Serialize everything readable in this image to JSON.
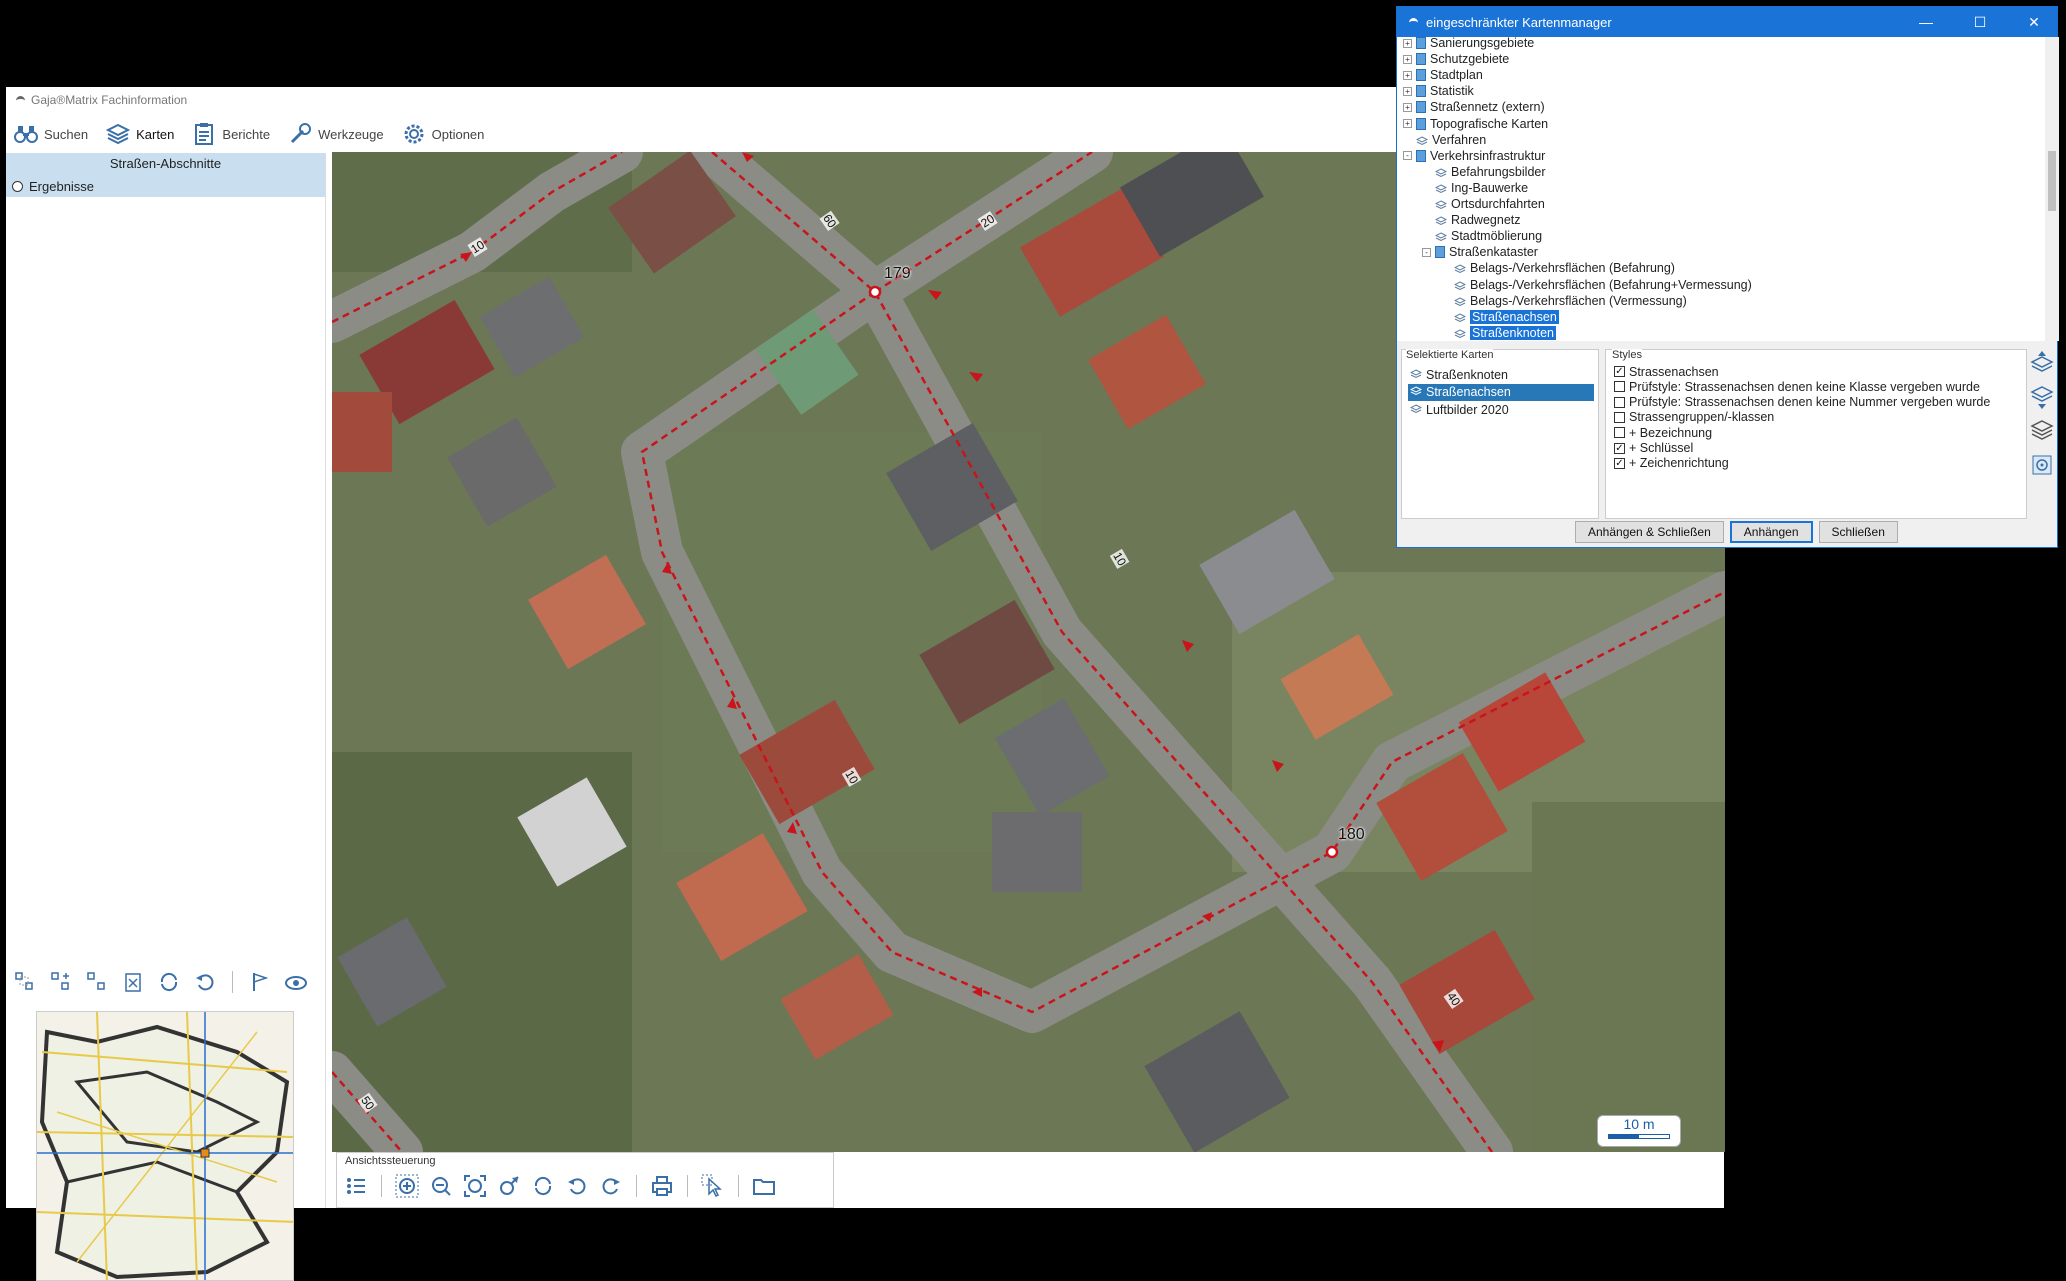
{
  "app": {
    "title": "Gaja®Matrix Fachinformation",
    "toolbar": [
      {
        "label": "Suchen",
        "icon": "binoculars-icon"
      },
      {
        "label": "Karten",
        "icon": "layers-icon"
      },
      {
        "label": "Berichte",
        "icon": "report-icon"
      },
      {
        "label": "Werkzeuge",
        "icon": "wrench-icon"
      },
      {
        "label": "Optionen",
        "icon": "gear-icon"
      }
    ],
    "active_tab": "Karten"
  },
  "left_panel": {
    "header": "Straßen-Abschnitte",
    "results_label": "Ergebnisse"
  },
  "map": {
    "node_labels": [
      "179",
      "180"
    ],
    "road_labels": [
      "10",
      "60",
      "20",
      "10",
      "10",
      "40",
      "50"
    ],
    "scale_label": "10 m"
  },
  "view_control": {
    "label": "Ansichtssteuerung"
  },
  "dialog": {
    "title": "eingeschränkter Kartenmanager",
    "tree": [
      {
        "label": "Sanierungsgebiete",
        "level": 0,
        "type": "book",
        "exp": "+"
      },
      {
        "label": "Schutzgebiete",
        "level": 0,
        "type": "book",
        "exp": "+"
      },
      {
        "label": "Stadtplan",
        "level": 0,
        "type": "book",
        "exp": "+"
      },
      {
        "label": "Statistik",
        "level": 0,
        "type": "book",
        "exp": "+"
      },
      {
        "label": "Straßennetz (extern)",
        "level": 0,
        "type": "book",
        "exp": "+"
      },
      {
        "label": "Topografische Karten",
        "level": 0,
        "type": "book",
        "exp": "+"
      },
      {
        "label": "Verfahren",
        "level": 0,
        "type": "layer",
        "exp": ""
      },
      {
        "label": "Verkehrsinfrastruktur",
        "level": 0,
        "type": "book",
        "exp": "-"
      },
      {
        "label": "Befahrungsbilder",
        "level": 1,
        "type": "layer",
        "exp": ""
      },
      {
        "label": "Ing-Bauwerke",
        "level": 1,
        "type": "layer",
        "exp": ""
      },
      {
        "label": "Ortsdurchfahrten",
        "level": 1,
        "type": "layer",
        "exp": ""
      },
      {
        "label": "Radwegnetz",
        "level": 1,
        "type": "layer",
        "exp": ""
      },
      {
        "label": "Stadtmöblierung",
        "level": 1,
        "type": "layer",
        "exp": ""
      },
      {
        "label": "Straßenkataster",
        "level": 1,
        "type": "book",
        "exp": "-"
      },
      {
        "label": "Belags-/Verkehrsflächen (Befahrung)",
        "level": 2,
        "type": "layer",
        "exp": ""
      },
      {
        "label": "Belags-/Verkehrsflächen (Befahrung+Vermessung)",
        "level": 2,
        "type": "layer",
        "exp": ""
      },
      {
        "label": "Belags-/Verkehrsflächen (Vermessung)",
        "level": 2,
        "type": "layer",
        "exp": ""
      },
      {
        "label": "Straßenachsen",
        "level": 2,
        "type": "layer",
        "exp": "",
        "selected": true
      },
      {
        "label": "Straßenknoten",
        "level": 2,
        "type": "layer",
        "exp": "",
        "selected": true
      }
    ],
    "selected_maps_header": "Selektierte Karten",
    "selected_maps": [
      {
        "label": "Straßenknoten",
        "selected": false
      },
      {
        "label": "Straßenachsen",
        "selected": true
      },
      {
        "label": "Luftbilder 2020",
        "selected": false
      }
    ],
    "styles_header": "Styles",
    "styles": [
      {
        "label": "Strassenachsen",
        "checked": true
      },
      {
        "label": "Prüfstyle: Strassenachsen denen keine Klasse vergeben wurde",
        "checked": false
      },
      {
        "label": "Prüfstyle: Strassenachsen denen keine Nummer vergeben wurde",
        "checked": false
      },
      {
        "label": "Strassengruppen/-klassen",
        "checked": false
      },
      {
        "label": "+ Bezeichnung",
        "checked": false
      },
      {
        "label": "+ Schlüssel",
        "checked": true
      },
      {
        "label": "+ Zeichenrichtung",
        "checked": true
      }
    ],
    "buttons": {
      "attach_close": "Anhängen & Schließen",
      "attach": "Anhängen",
      "close": "Schließen"
    },
    "colors": {
      "accent": "#1a73d6",
      "selection": "#2878b8"
    }
  }
}
